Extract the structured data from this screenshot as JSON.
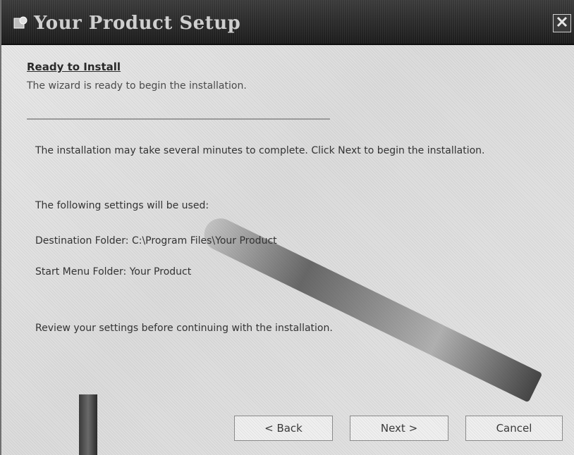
{
  "window": {
    "title": "Your Product Setup",
    "app_icon": "setup-icon",
    "close_icon": "close-icon"
  },
  "content": {
    "heading": "Ready to Install",
    "subheading": "The wizard is ready to begin the installation.",
    "lines": [
      "The installation may take several minutes to complete. Click Next to begin the installation.",
      "The following settings will be used:",
      "Destination Folder: C:\\Program Files\\Your Product",
      "Start Menu Folder: Your Product",
      "Review your settings before continuing with the installation."
    ]
  },
  "buttons": {
    "back": "< Back",
    "next": "Next >",
    "cancel": "Cancel"
  },
  "colors": {
    "titlebar": "#1b1b1b",
    "title_text": "#cfcfcf",
    "dialog_bg": "#e2e2e2"
  }
}
